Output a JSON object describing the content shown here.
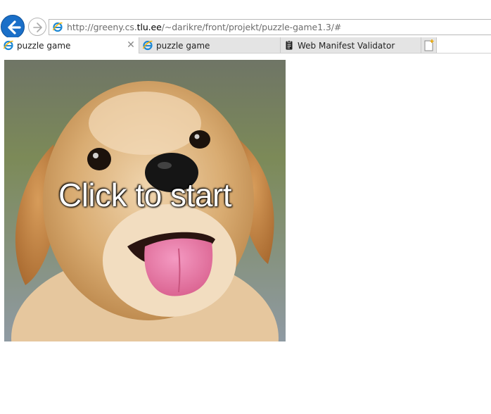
{
  "browser": {
    "address_bar": {
      "url_prefix": "http://greeny.cs.",
      "url_domain": "tlu.ee",
      "url_suffix": "/~darikre/front/projekt/puzzle-game1.3/#"
    },
    "tabs": [
      {
        "label": "puzzle game",
        "active": true,
        "icon": "ie-page-icon"
      },
      {
        "label": "puzzle game",
        "active": false,
        "icon": "ie-page-icon"
      },
      {
        "label": "Web Manifest Validator",
        "active": false,
        "icon": "clipboard-icon"
      }
    ],
    "colors": {
      "back_button": "#1a6fc8",
      "ie_icon": "#1e88d4"
    }
  },
  "page": {
    "puzzle": {
      "image_subject": "golden retriever puppy",
      "overlay_text": "Click to start"
    }
  }
}
